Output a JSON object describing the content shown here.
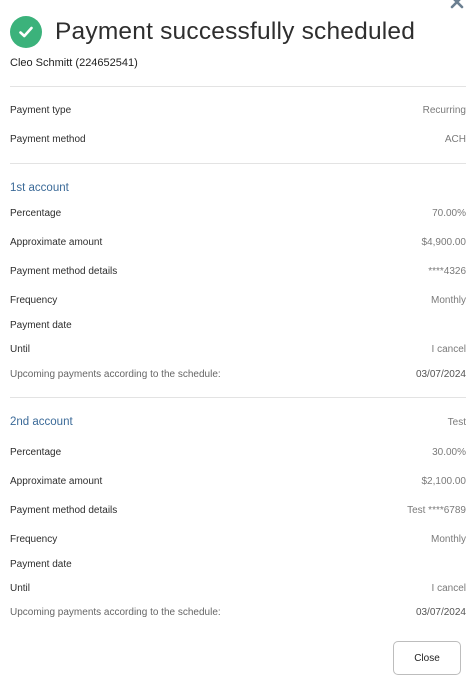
{
  "dialog": {
    "title": "Payment successfully scheduled",
    "customer": "Cleo Schmitt (224652541)",
    "close_label": "Close"
  },
  "summary": [
    {
      "label": "Payment type",
      "value": "Recurring"
    },
    {
      "label": "Payment method",
      "value": "ACH"
    }
  ],
  "accounts": [
    {
      "title": "1st account",
      "title_value": "",
      "rows": [
        {
          "label": "Percentage",
          "value": "70.00%"
        },
        {
          "label": "Approximate amount",
          "value": "$4,900.00"
        },
        {
          "label": "Payment method details",
          "value": "****4326"
        },
        {
          "label": "Frequency",
          "value": "Monthly"
        },
        {
          "label": "Payment date",
          "value": ""
        },
        {
          "label": "Until",
          "value": "I cancel"
        },
        {
          "label": "Upcoming payments according to the schedule:",
          "value": "03/07/2024"
        }
      ]
    },
    {
      "title": "2nd account",
      "title_value": "Test",
      "rows": [
        {
          "label": "Percentage",
          "value": "30.00%"
        },
        {
          "label": "Approximate amount",
          "value": "$2,100.00"
        },
        {
          "label": "Payment method details",
          "value": "Test ****6789"
        },
        {
          "label": "Frequency",
          "value": "Monthly"
        },
        {
          "label": "Payment date",
          "value": ""
        },
        {
          "label": "Until",
          "value": "I cancel"
        },
        {
          "label": "Upcoming payments according to the schedule:",
          "value": "03/07/2024"
        }
      ]
    }
  ],
  "icons": {
    "success": "check-circle-icon",
    "close": "close-x-icon"
  },
  "colors": {
    "success": "#3bb27b",
    "section_title": "#3b6a98",
    "close_x": "#6b7f91"
  }
}
